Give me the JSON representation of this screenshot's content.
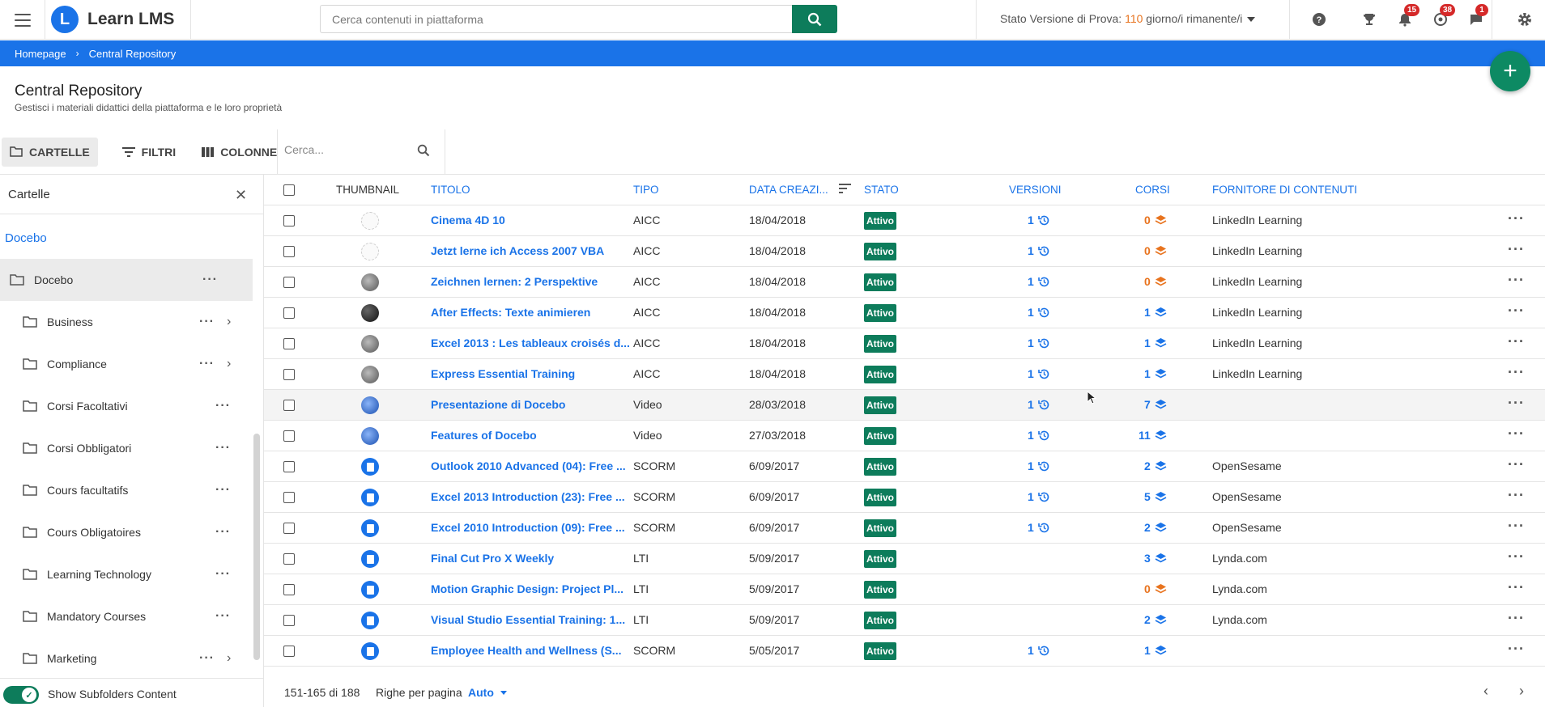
{
  "app": {
    "logo_letter": "L",
    "name": "Learn LMS"
  },
  "search": {
    "placeholder": "Cerca contenuti in piattaforma"
  },
  "trial": {
    "prefix": "Stato Versione di Prova: ",
    "days": "110",
    "suffix": " giorno/i rimanente/i"
  },
  "header_badges": {
    "notifications": "15",
    "messages": "38",
    "chat": "1"
  },
  "breadcrumb": {
    "home": "Homepage",
    "current": "Central Repository"
  },
  "page": {
    "title": "Central Repository",
    "subtitle": "Gestisci i materiali didattici della piattaforma e le loro proprietà"
  },
  "toolbar": {
    "folders": "CARTELLE",
    "filters": "FILTRI",
    "columns": "COLONNE",
    "search_placeholder": "Cerca..."
  },
  "sidebar": {
    "title": "Cartelle",
    "root_link": "Docebo",
    "items": [
      {
        "label": "Docebo",
        "level": 0,
        "selected": true,
        "arrow": false
      },
      {
        "label": "Business",
        "level": 1,
        "selected": false,
        "arrow": true
      },
      {
        "label": "Compliance",
        "level": 1,
        "selected": false,
        "arrow": true
      },
      {
        "label": "Corsi Facoltativi",
        "level": 1,
        "selected": false,
        "arrow": false
      },
      {
        "label": "Corsi Obbligatori",
        "level": 1,
        "selected": false,
        "arrow": false
      },
      {
        "label": "Cours facultatifs",
        "level": 1,
        "selected": false,
        "arrow": false
      },
      {
        "label": "Cours Obligatoires",
        "level": 1,
        "selected": false,
        "arrow": false
      },
      {
        "label": "Learning Technology",
        "level": 1,
        "selected": false,
        "arrow": false
      },
      {
        "label": "Mandatory Courses",
        "level": 1,
        "selected": false,
        "arrow": false
      },
      {
        "label": "Marketing",
        "level": 1,
        "selected": false,
        "arrow": true
      }
    ],
    "footer_toggle_label": "Show Subfolders Content"
  },
  "table": {
    "headers": {
      "thumbnail": "THUMBNAIL",
      "title": "TITOLO",
      "type": "TIPO",
      "date": "DATA CREAZI...",
      "status": "STATO",
      "versions": "VERSIONI",
      "courses": "CORSI",
      "provider": "FORNITORE DI CONTENUTI"
    },
    "rows": [
      {
        "thumb": "blank",
        "title": "Cinema 4D 10",
        "type": "AICC",
        "date": "18/04/2018",
        "status": "Attivo",
        "versions": "1",
        "courses": "0",
        "provider": "LinkedIn Learning"
      },
      {
        "thumb": "blank",
        "title": "Jetzt lerne ich Access 2007 VBA",
        "type": "AICC",
        "date": "18/04/2018",
        "status": "Attivo",
        "versions": "1",
        "courses": "0",
        "provider": "LinkedIn Learning"
      },
      {
        "thumb": "gray",
        "title": "Zeichnen lernen: 2 Perspektive",
        "type": "AICC",
        "date": "18/04/2018",
        "status": "Attivo",
        "versions": "1",
        "courses": "0",
        "provider": "LinkedIn Learning"
      },
      {
        "thumb": "dark",
        "title": "After Effects: Texte animieren",
        "type": "AICC",
        "date": "18/04/2018",
        "status": "Attivo",
        "versions": "1",
        "courses": "1",
        "provider": "LinkedIn Learning"
      },
      {
        "thumb": "gray",
        "title": "Excel 2013 : Les tableaux croisés d...",
        "type": "AICC",
        "date": "18/04/2018",
        "status": "Attivo",
        "versions": "1",
        "courses": "1",
        "provider": "LinkedIn Learning"
      },
      {
        "thumb": "gray",
        "title": "Express Essential Training",
        "type": "AICC",
        "date": "18/04/2018",
        "status": "Attivo",
        "versions": "1",
        "courses": "1",
        "provider": "LinkedIn Learning"
      },
      {
        "thumb": "globe",
        "title": "Presentazione di Docebo",
        "type": "Video",
        "date": "28/03/2018",
        "status": "Attivo",
        "versions": "1",
        "courses": "7",
        "provider": ""
      },
      {
        "thumb": "globe",
        "title": "Features of Docebo",
        "type": "Video",
        "date": "27/03/2018",
        "status": "Attivo",
        "versions": "1",
        "courses": "11",
        "provider": ""
      },
      {
        "thumb": "doc",
        "title": "Outlook 2010 Advanced (04): Free ...",
        "type": "SCORM",
        "date": "6/09/2017",
        "status": "Attivo",
        "versions": "1",
        "courses": "2",
        "provider": "OpenSesame"
      },
      {
        "thumb": "doc",
        "title": "Excel 2013 Introduction (23): Free ...",
        "type": "SCORM",
        "date": "6/09/2017",
        "status": "Attivo",
        "versions": "1",
        "courses": "5",
        "provider": "OpenSesame"
      },
      {
        "thumb": "doc",
        "title": "Excel 2010 Introduction (09): Free ...",
        "type": "SCORM",
        "date": "6/09/2017",
        "status": "Attivo",
        "versions": "1",
        "courses": "2",
        "provider": "OpenSesame"
      },
      {
        "thumb": "doc",
        "title": "Final Cut Pro X Weekly",
        "type": "LTI",
        "date": "5/09/2017",
        "status": "Attivo",
        "versions": "",
        "courses": "3",
        "provider": "Lynda.com"
      },
      {
        "thumb": "doc",
        "title": "Motion Graphic Design: Project Pl...",
        "type": "LTI",
        "date": "5/09/2017",
        "status": "Attivo",
        "versions": "",
        "courses": "0",
        "provider": "Lynda.com"
      },
      {
        "thumb": "doc",
        "title": "Visual Studio Essential Training: 1...",
        "type": "LTI",
        "date": "5/09/2017",
        "status": "Attivo",
        "versions": "",
        "courses": "2",
        "provider": "Lynda.com"
      },
      {
        "thumb": "doc",
        "title": "Employee Health and Wellness (S...",
        "type": "SCORM",
        "date": "5/05/2017",
        "status": "Attivo",
        "versions": "1",
        "courses": "1",
        "provider": ""
      }
    ]
  },
  "pager": {
    "range": "151-165 di 188",
    "rows_per_page_label": "Righe per pagina",
    "rows_per_page_value": "Auto"
  },
  "colors": {
    "brand_blue": "#1a73e8",
    "green": "#0d7c5b",
    "orange": "#e8731e",
    "badge_red": "#d52929"
  }
}
